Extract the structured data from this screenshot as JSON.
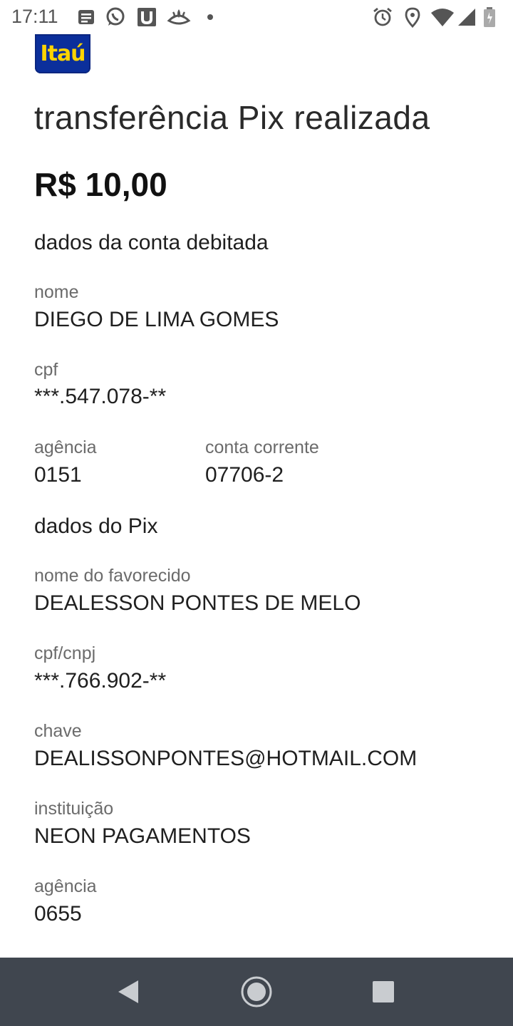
{
  "status_bar": {
    "time": "17:11",
    "left_icons": [
      "notes-icon",
      "whatsapp-icon",
      "app-u-icon",
      "santander-icon",
      "dot-icon"
    ],
    "right_icons": [
      "alarm-icon",
      "location-icon",
      "wifi-icon",
      "signal-icon",
      "battery-icon"
    ]
  },
  "header": {
    "logo_text": "Itaú",
    "title": "transferência Pix realizada",
    "amount": "R$ 10,00"
  },
  "debited_account": {
    "section_title": "dados da conta debitada",
    "name_label": "nome",
    "name_value": "DIEGO DE LIMA GOMES",
    "cpf_label": "cpf",
    "cpf_value": "***.547.078-**",
    "agency_label": "agência",
    "agency_value": "0151",
    "account_label": "conta corrente",
    "account_value": "07706-2"
  },
  "pix_data": {
    "section_title": "dados do Pix",
    "payee_label": "nome do favorecido",
    "payee_value": "DEALESSON PONTES DE MELO",
    "doc_label": "cpf/cnpj",
    "doc_value": "***.766.902-**",
    "key_label": "chave",
    "key_value": "DEALISSONPONTES@HOTMAIL.COM",
    "institution_label": "instituição",
    "institution_value": "NEON PAGAMENTOS",
    "agency_label": "agência",
    "agency_value": "0655"
  },
  "colors": {
    "brand_blue": "#0b2f9b",
    "brand_yellow": "#ffd400",
    "nav_bar": "#40464f"
  }
}
